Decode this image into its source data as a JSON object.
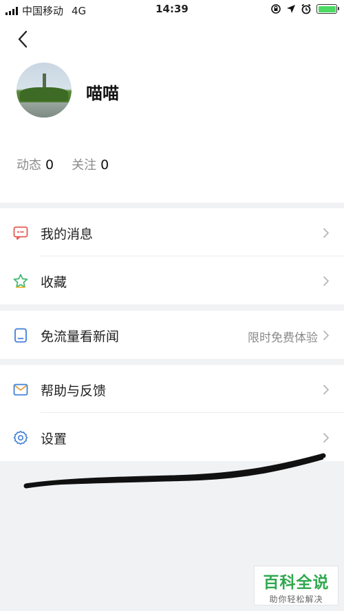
{
  "status_bar": {
    "carrier": "中国移动",
    "network": "4G",
    "time": "14:39",
    "battery_level": 1.0,
    "battery_color": "#4cd964"
  },
  "profile": {
    "username": "喵喵",
    "stats": [
      {
        "label": "动态",
        "value": "0"
      },
      {
        "label": "关注",
        "value": "0"
      }
    ]
  },
  "menu": {
    "messages": {
      "label": "我的消息",
      "icon": "message-icon",
      "icon_color": "#e2584f"
    },
    "favorites": {
      "label": "收藏",
      "icon": "star-icon",
      "icon_color": "#3bb56d"
    },
    "free_news": {
      "label": "免流量看新闻",
      "extra": "限时免费体验",
      "icon": "document-icon",
      "icon_color": "#3f7fd6"
    },
    "feedback": {
      "label": "帮助与反馈",
      "icon": "mail-icon",
      "icon_color": "#e6a23c"
    },
    "settings": {
      "label": "设置",
      "icon": "gear-icon",
      "icon_color": "#3f7fd6"
    }
  },
  "watermark": {
    "title": "百科全说",
    "subtitle": "助你轻松解决"
  }
}
